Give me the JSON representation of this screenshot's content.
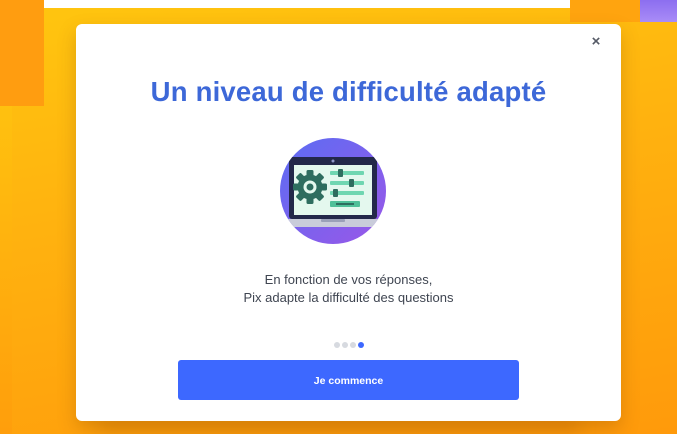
{
  "modal": {
    "title": "Un niveau de difficulté adapté",
    "close_icon": "close-icon",
    "close_glyph": "×",
    "description_line1": "En fonction de vos réponses,",
    "description_line2": "Pix adapte la difficulté des questions",
    "illustration_icon": "laptop-settings-icon",
    "pager": {
      "total": 4,
      "active_index": 3
    },
    "start_button_label": "Je commence"
  },
  "colors": {
    "title": "#3d68d8",
    "primary_button": "#3d68ff",
    "background_top": "#ffc60f",
    "background_bottom": "#ff9a0b",
    "illustration_circle": "#7b5ff0",
    "laptop_screen": "#e4f8ee",
    "gear": "#2e6d5f"
  }
}
